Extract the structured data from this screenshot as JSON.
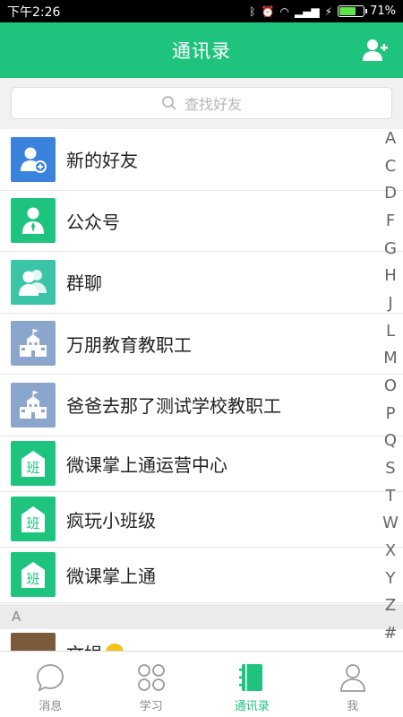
{
  "status_bar": {
    "time": "下午2:26",
    "battery_text": "71%",
    "battery_level": 0.71,
    "icons": [
      "bluetooth-icon",
      "alarm-icon",
      "wifi-icon",
      "signal-icon",
      "charging-icon",
      "battery-icon"
    ]
  },
  "header": {
    "title": "通讯录",
    "action_icon": "add-friend-icon"
  },
  "search": {
    "placeholder": "查找好友",
    "icon": "search-icon"
  },
  "contacts": [
    {
      "label": "新的好友",
      "icon": "new-friend-icon",
      "color": "#3a83dd"
    },
    {
      "label": "公众号",
      "icon": "official-account-icon",
      "color": "#1ec47e"
    },
    {
      "label": "群聊",
      "icon": "group-chat-icon",
      "color": "#3cc4a6"
    },
    {
      "label": "万朋教育教职工",
      "icon": "school-building-icon",
      "color": "#8aa6cc"
    },
    {
      "label": "爸爸去那了测试学校教职工",
      "icon": "school-building-icon",
      "color": "#8aa6cc"
    },
    {
      "label": "微课掌上通运营中心",
      "icon": "class-icon",
      "color": "#1ec47e",
      "badge": "班"
    },
    {
      "label": "疯玩小班级",
      "icon": "class-icon",
      "color": "#1ec47e",
      "badge": "班"
    },
    {
      "label": "微课掌上通",
      "icon": "class-icon",
      "color": "#1ec47e",
      "badge": "班"
    }
  ],
  "section": {
    "header": "A",
    "partial_item": "文娟"
  },
  "index_letters": [
    "A",
    "C",
    "D",
    "F",
    "G",
    "H",
    "J",
    "L",
    "M",
    "O",
    "P",
    "Q",
    "S",
    "T",
    "W",
    "X",
    "Y",
    "Z",
    "#"
  ],
  "tabs": [
    {
      "label": "消息",
      "icon": "chat-bubble-icon",
      "active": false
    },
    {
      "label": "学习",
      "icon": "study-grid-icon",
      "active": false
    },
    {
      "label": "通讯录",
      "icon": "contacts-book-icon",
      "active": true
    },
    {
      "label": "我",
      "icon": "profile-icon",
      "active": false
    }
  ],
  "colors": {
    "accent": "#1ec47e",
    "header_bg": "#1ec47e",
    "section_bg": "#ebebeb"
  }
}
